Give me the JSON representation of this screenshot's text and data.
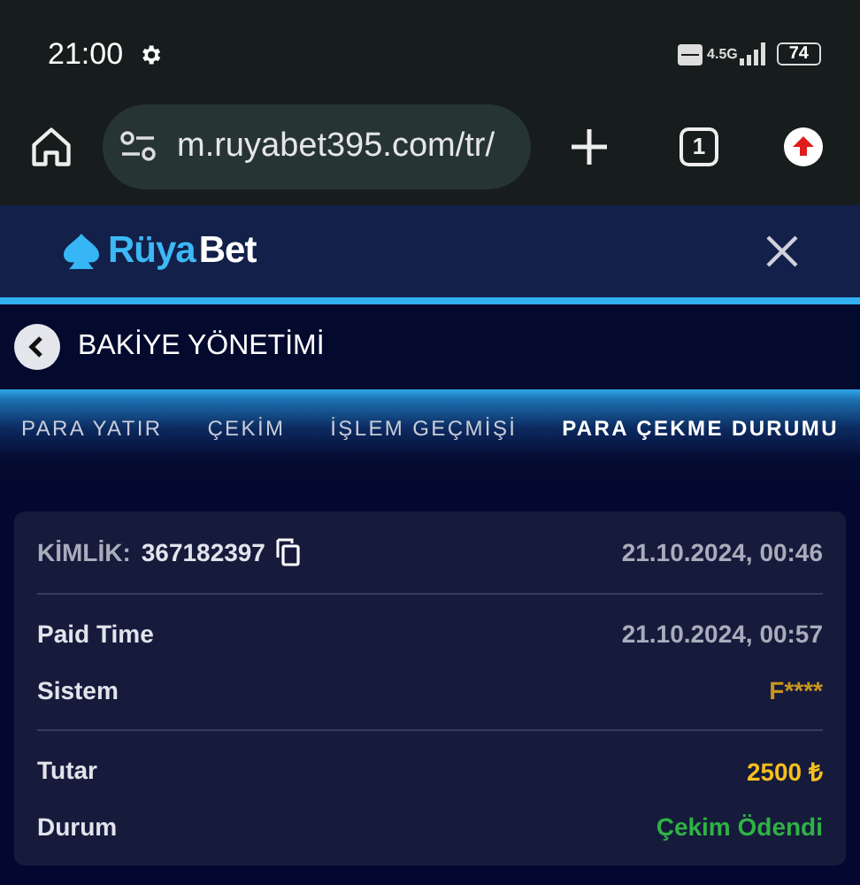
{
  "status_bar": {
    "time": "21:00",
    "network": "4.5G",
    "battery": "74"
  },
  "browser": {
    "url": "m.ruyabet395.com/tr/",
    "tab_count": "1"
  },
  "header": {
    "logo": [
      "Rüya",
      "Bet"
    ]
  },
  "page": {
    "title": "BAKİYE YÖNETİMİ"
  },
  "tabs": [
    {
      "label": "PARA YATIR",
      "selected": false
    },
    {
      "label": "ÇEKİM",
      "selected": false
    },
    {
      "label": "İŞLEM GEÇMİŞİ",
      "selected": false
    },
    {
      "label": "PARA ÇEKME DURUMU",
      "selected": true
    }
  ],
  "card": {
    "id_label": "KİMLİK:",
    "id_value": "367182397",
    "date": "21.10.2024, 00:46",
    "sections": [
      [
        {
          "label": "Paid Time",
          "value": "21.10.2024, 00:57",
          "color": "#a9acbb"
        },
        {
          "label": "Sistem",
          "value": "F****",
          "color": "#c9961e"
        }
      ],
      [
        {
          "label": "Tutar",
          "value": "2500 ₺",
          "color": "#f7bf1e"
        },
        {
          "label": "Durum",
          "value": "Çekim Ödendi",
          "color": "#2fb344"
        }
      ]
    ]
  }
}
